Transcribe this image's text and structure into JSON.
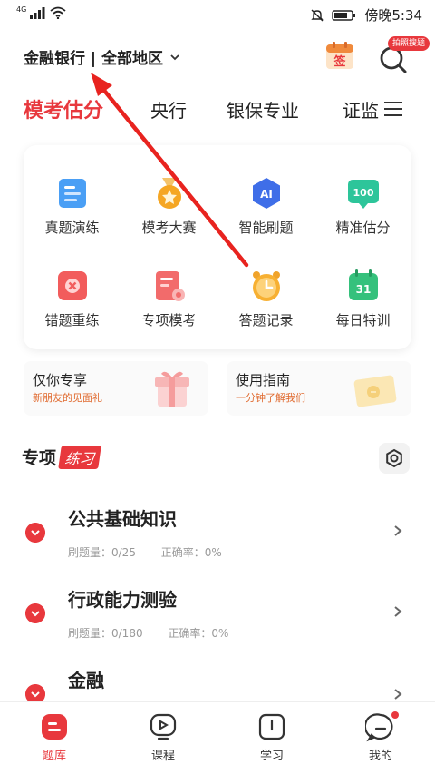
{
  "status_bar": {
    "network": "4G",
    "time": "傍晚5:34"
  },
  "header": {
    "region_label": "金融银行 | 全部地区",
    "calendar_label": "签",
    "photo_search_badge": "拍照搜题"
  },
  "tabs": [
    {
      "label": "模考估分",
      "active": true
    },
    {
      "label": "央行"
    },
    {
      "label": "银保专业"
    },
    {
      "label": "证监"
    }
  ],
  "grid": [
    {
      "label": "真题演练",
      "icon": "document-icon"
    },
    {
      "label": "模考大赛",
      "icon": "medal-icon"
    },
    {
      "label": "智能刷题",
      "icon": "ai-icon",
      "icon_text": "AI"
    },
    {
      "label": "精准估分",
      "icon": "score-icon",
      "icon_text": "100"
    },
    {
      "label": "错题重练",
      "icon": "wrong-icon"
    },
    {
      "label": "专项模考",
      "icon": "exam-icon"
    },
    {
      "label": "答题记录",
      "icon": "clock-icon"
    },
    {
      "label": "每日特训",
      "icon": "calendar-icon",
      "icon_text": "31"
    }
  ],
  "promos": [
    {
      "title": "仅你专享",
      "subtitle": "新朋友的见面礼"
    },
    {
      "title": "使用指南",
      "subtitle": "一分钟了解我们"
    }
  ],
  "special": {
    "title": "专项",
    "tag": "练习"
  },
  "subjects": [
    {
      "name": "公共基础知识",
      "count": "刷题量：0/25",
      "accuracy": "正确率：0%"
    },
    {
      "name": "行政能力测验",
      "count": "刷题量：0/180",
      "accuracy": "正确率：0%"
    },
    {
      "name": "金融",
      "count": "",
      "accuracy": ""
    }
  ],
  "bottom_nav": [
    {
      "label": "题库",
      "active": true
    },
    {
      "label": "课程"
    },
    {
      "label": "学习"
    },
    {
      "label": "我的"
    }
  ],
  "colors": {
    "accent": "#e8383d",
    "orange": "#f5a623"
  }
}
